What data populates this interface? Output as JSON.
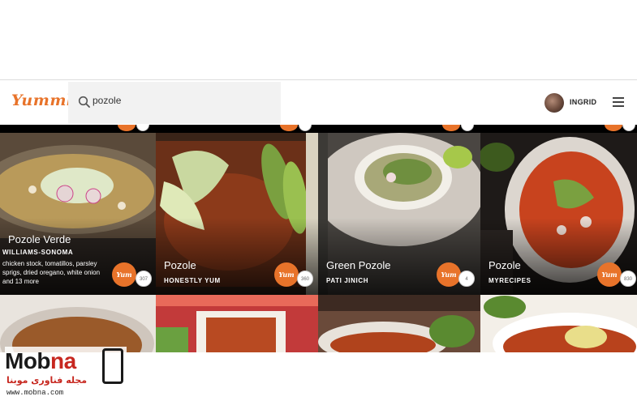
{
  "brand": {
    "name": "Yummly"
  },
  "search": {
    "value": "pozole"
  },
  "user": {
    "name": "INGRID"
  },
  "cards": [
    {
      "title": "Pozole Verde",
      "source": "WILLIAMS-SONOMA",
      "ingredients": "chicken stock, tomatillos, parsley sprigs, dried oregano, white onion and 13 more",
      "yum_label": "Yum",
      "yum_count": "307"
    },
    {
      "title": "Pozole",
      "source": "HONESTLY YUM",
      "ingredients": "",
      "yum_label": "Yum",
      "yum_count": "360"
    },
    {
      "title": "Green Pozole",
      "source": "PATI JINICH",
      "ingredients": "",
      "yum_label": "Yum",
      "yum_count": "4"
    },
    {
      "title": "Pozole",
      "source": "MYRECIPES",
      "ingredients": "",
      "yum_label": "Yum",
      "yum_count": "830"
    }
  ],
  "watermark": {
    "brand_dark": "Mob",
    "brand_red": "na",
    "subtitle": "مجله فناوری موبنا",
    "url": "www.mobna.com"
  },
  "colors": {
    "accent": "#e8732a",
    "watermark_red": "#c7271f"
  },
  "icons": [
    "search-icon",
    "hamburger-menu-icon",
    "avatar"
  ]
}
